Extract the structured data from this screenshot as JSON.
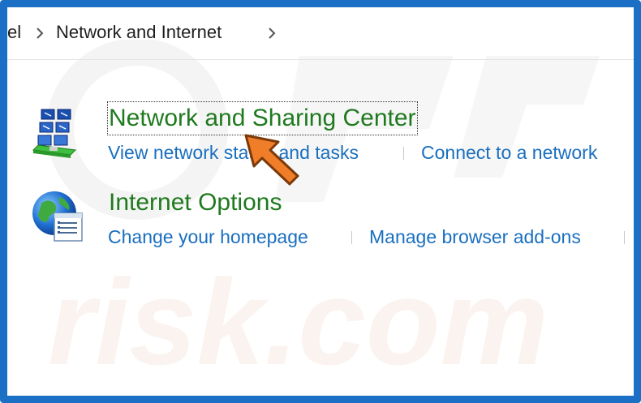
{
  "breadcrumb": {
    "items": [
      "el",
      "Network and Internet"
    ]
  },
  "categories": [
    {
      "title": "Network and Sharing Center",
      "icon": "network-sharing-icon",
      "tasks": [
        "View network status and tasks",
        "Connect to a network"
      ]
    },
    {
      "title": "Internet Options",
      "icon": "internet-options-icon",
      "tasks": [
        "Change your homepage",
        "Manage browser add-ons"
      ]
    }
  ],
  "watermark": {
    "text": "risk.com"
  },
  "colors": {
    "frame": "#1b6fc4",
    "title_green": "#1f7a1f",
    "link_blue": "#1a6fbf",
    "arrow_orange": "#f07d28"
  }
}
